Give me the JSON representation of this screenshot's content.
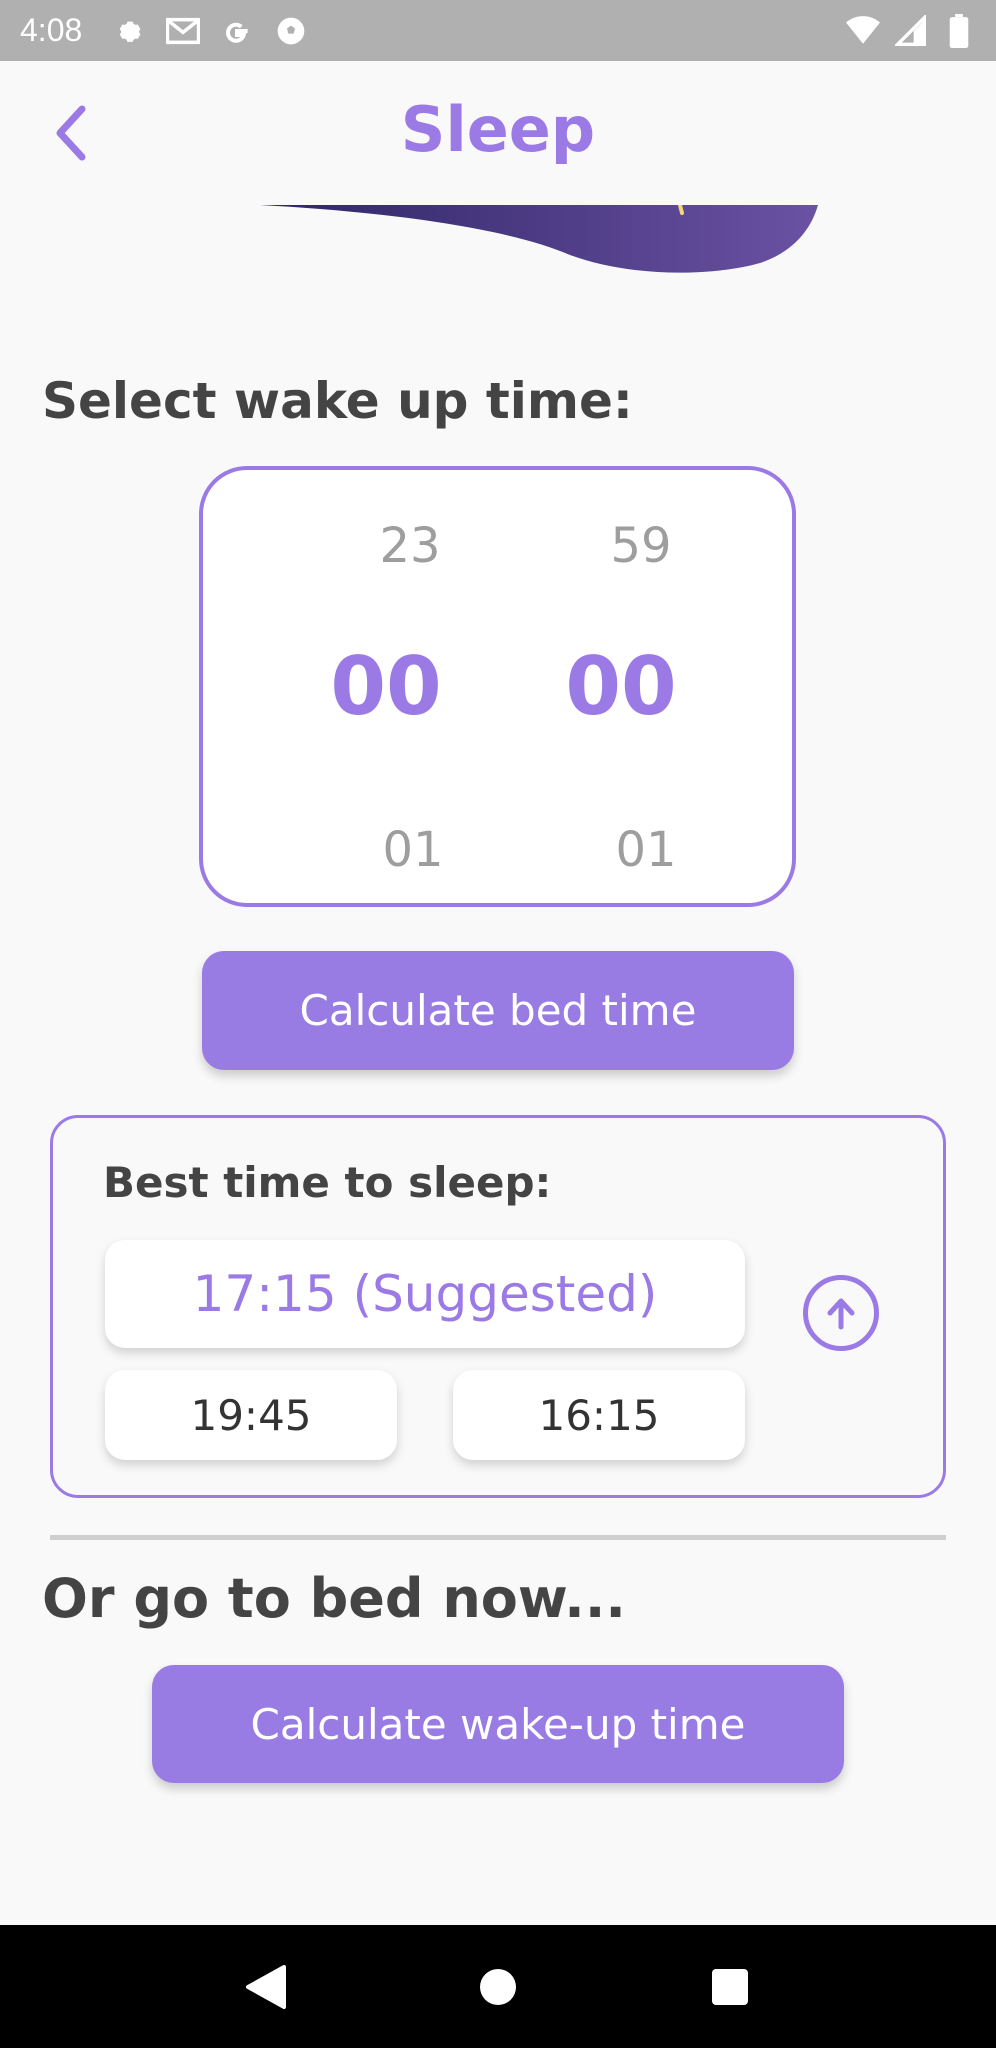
{
  "status_bar": {
    "time": "4:08",
    "left_icons": [
      "gear-icon",
      "gmail-icon",
      "google-icon",
      "soccer-ball-icon"
    ],
    "right_icons": [
      "wifi-icon",
      "signal-icon",
      "battery-icon"
    ]
  },
  "app_bar": {
    "title": "Sleep",
    "back_icon": "chevron-left-icon"
  },
  "wake_section": {
    "title": "Select wake up time:",
    "picker": {
      "hours": {
        "prev": "23",
        "selected": "00",
        "next": "01"
      },
      "minutes": {
        "prev": "59",
        "selected": "00",
        "next": "01"
      }
    },
    "calculate_button": "Calculate bed time"
  },
  "results": {
    "title": "Best time to sleep:",
    "suggested": "17:15 (Suggested)",
    "options": [
      "19:45",
      "16:15"
    ],
    "collapse_icon": "arrow-up-circle-icon"
  },
  "bed_now": {
    "title": "Or go to bed now...",
    "button": "Calculate wake-up time"
  },
  "nav_bar": {
    "icons": [
      "back-triangle-icon",
      "home-circle-icon",
      "recents-square-icon"
    ]
  },
  "colors": {
    "accent": "#9b7ae6",
    "button": "#987be3",
    "text_dark": "#444444",
    "status_bar": "#b0b0b0"
  }
}
